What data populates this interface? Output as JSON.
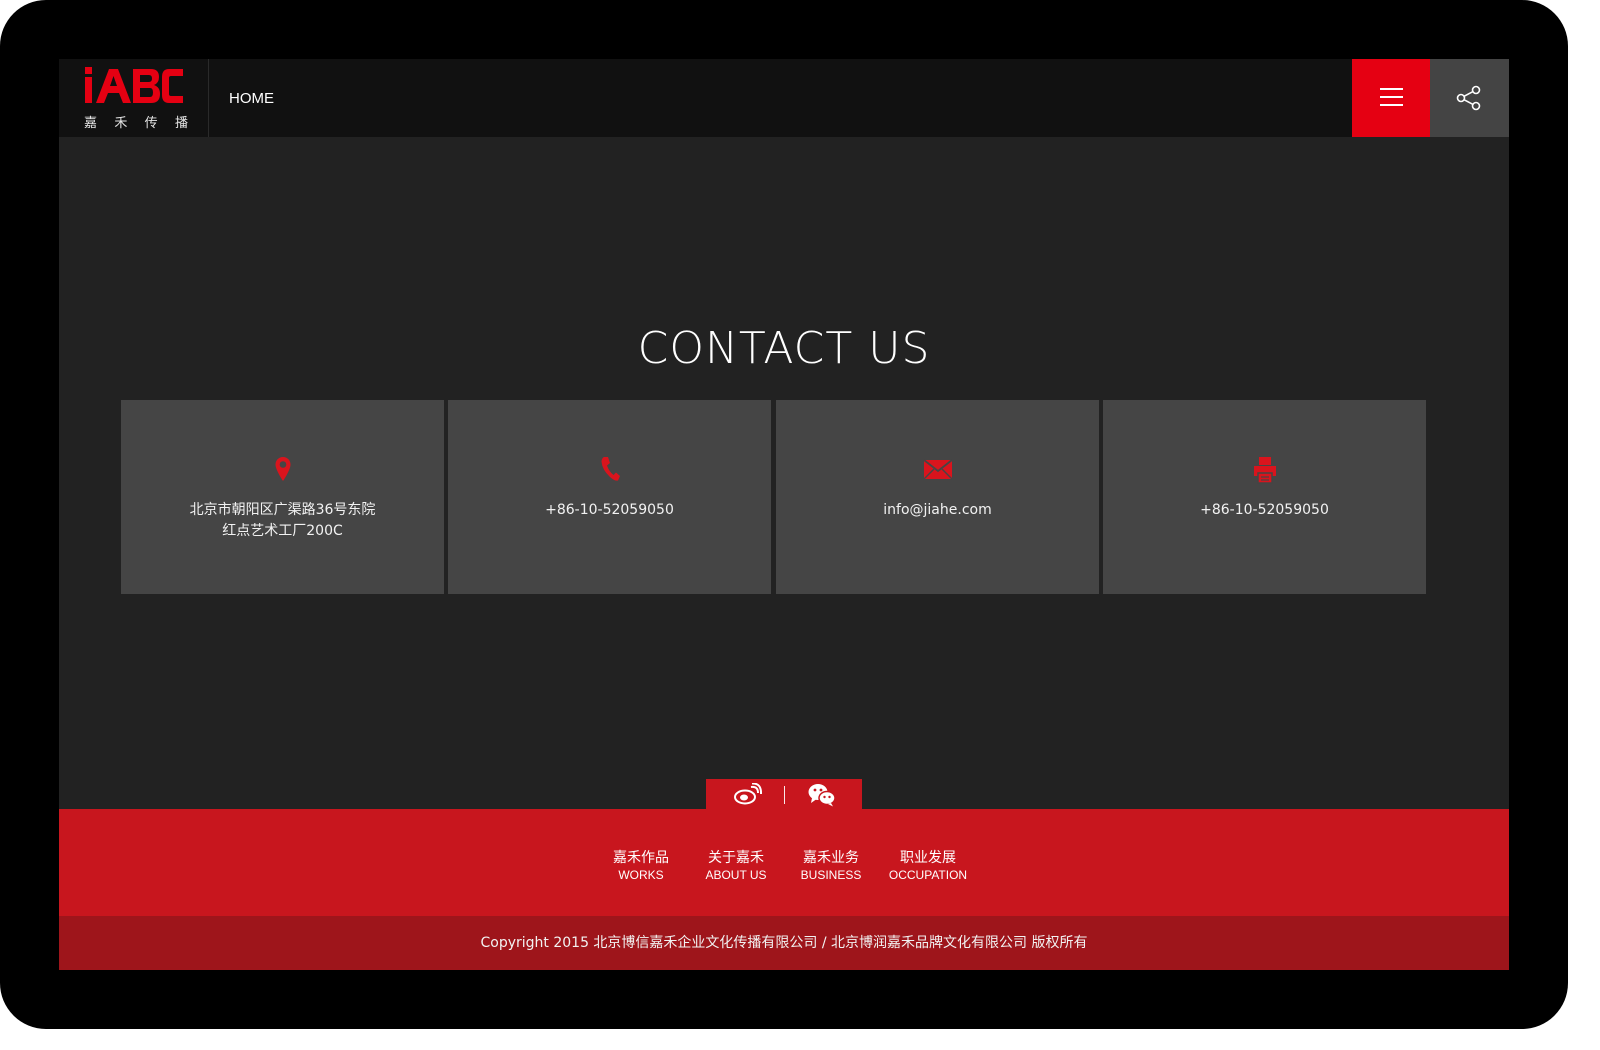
{
  "brand": {
    "logo_text": "iABC",
    "logo_cn_chars": [
      "嘉",
      "禾",
      "传",
      "播"
    ],
    "accent_color": "#e50012"
  },
  "header": {
    "nav_home": "HOME",
    "menu_icon": "hamburger-icon",
    "share_icon": "share-icon"
  },
  "main": {
    "title": "CONTACT US",
    "cards": [
      {
        "icon": "location-pin-icon",
        "line1": "北京市朝阳区广渠路36号东院",
        "line2": "红点艺术工厂200C"
      },
      {
        "icon": "phone-icon",
        "line1": "+86-10-52059050",
        "line2": ""
      },
      {
        "icon": "email-icon",
        "line1": "info@jiahe.com",
        "line2": ""
      },
      {
        "icon": "printer-icon",
        "line1": "+86-10-52059050",
        "line2": ""
      }
    ]
  },
  "social": {
    "weibo_icon": "weibo-icon",
    "wechat_icon": "wechat-icon"
  },
  "footer": {
    "nav": [
      {
        "cn": "嘉禾作品",
        "en": "WORKS"
      },
      {
        "cn": "关于嘉禾",
        "en": "ABOUT US"
      },
      {
        "cn": "嘉禾业务",
        "en": "BUSINESS"
      },
      {
        "cn": "职业发展",
        "en": "OCCUPATION"
      }
    ],
    "copyright": "Copyright 2015 北京博信嘉禾企业文化传播有限公司  /  北京博润嘉禾品牌文化有限公司 版权所有"
  }
}
